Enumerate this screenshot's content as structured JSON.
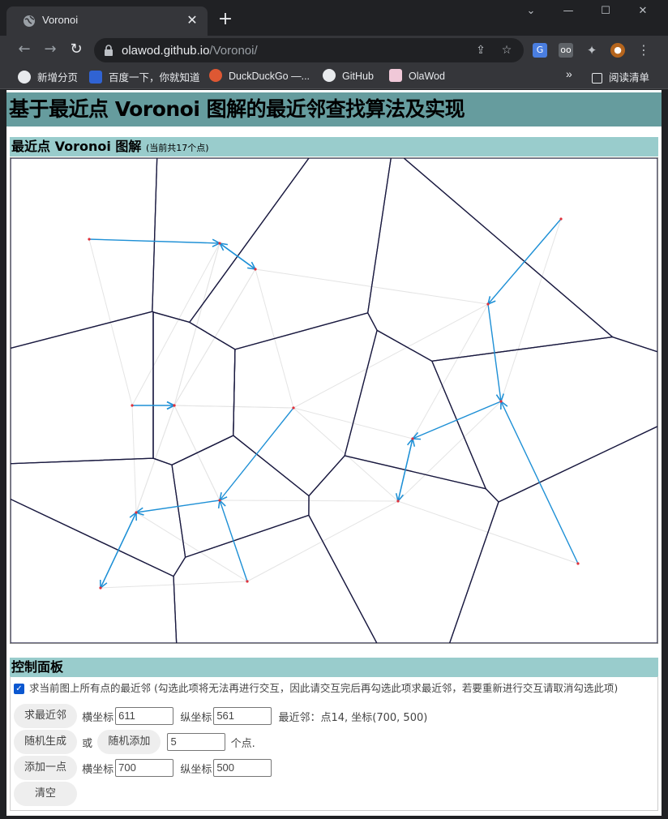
{
  "browser": {
    "tab_title": "Voronoi",
    "tab_close": "✕",
    "new_tab": "+",
    "url_host": "olawod.github.io",
    "url_path": "/Voronoi/",
    "bookmarks": [
      "新增分页",
      "百度一下，你就知道",
      "DuckDuckGo —...",
      "GitHub",
      "OlaWod"
    ],
    "reading_list": "阅读清单",
    "more_bookmarks": "»"
  },
  "page": {
    "title": "基于最近点 Voronoi 图解的最近邻查找算法及实现",
    "diagram_section": "最近点 Voronoi 图解",
    "point_count_note": "(当前共17个点)",
    "control_section": "控制面板",
    "checkbox_label": "求当前图上所有点的最近邻 (勾选此项将无法再进行交互，因此请交互完后再勾选此项求最近邻，若要重新进行交互请取消勾选此项)",
    "checkbox_checked": true,
    "nn_button": "求最近邻",
    "x_label": "横坐标",
    "y_label": "纵坐标",
    "nn_x": "611",
    "nn_y": "561",
    "nn_result": "最近邻：点14, 坐标(700, 500)",
    "random_gen_button": "随机生成",
    "or_text": "或",
    "random_add_button": "随机添加",
    "random_count": "5",
    "points_unit": "个点.",
    "add_point_button": "添加一点",
    "add_x": "700",
    "add_y": "500",
    "clear_button": "清空"
  },
  "colors": {
    "title_bg": "#669c9e",
    "section_bg": "#99cccc",
    "voronoi_edge": "#1a1a40",
    "nn_arrow": "#1e90d6",
    "delaunay": "#e4e4e4",
    "site": "#e0303a"
  },
  "chart_data": {
    "type": "scatter",
    "x": [
      97,
      302,
      202,
      349,
      258,
      155,
      111,
      292,
      589,
      679,
      605,
      496,
      478,
      700,
      258,
      150,
      202
    ],
    "y": [
      100,
      137,
      305,
      308,
      422,
      437,
      530,
      522,
      180,
      75,
      300,
      346,
      423,
      500,
      105,
      305,
      305
    ],
    "note_points": "sites of the nearest-point Voronoi diagram; blue arrows point to each site's nearest neighbour"
  }
}
